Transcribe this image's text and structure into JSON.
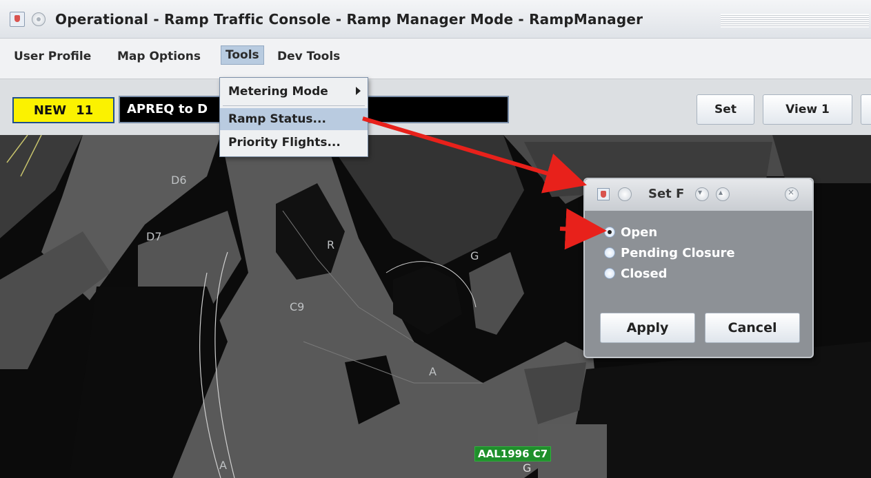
{
  "window": {
    "title": "Operational - Ramp Traffic Console - Ramp Manager Mode - RampManager"
  },
  "menubar": {
    "items": [
      {
        "label": "User Profile"
      },
      {
        "label": "Map Options"
      },
      {
        "label": "Tools"
      },
      {
        "label": "Dev Tools"
      }
    ],
    "active": "Tools"
  },
  "toolbar": {
    "new_label": "NEW",
    "new_count": "11",
    "message": "APREQ to D",
    "buttons": [
      {
        "label": "Set"
      },
      {
        "label": "View 1"
      }
    ]
  },
  "tools_menu": {
    "items": [
      {
        "label": "Metering Mode",
        "submenu": true
      },
      {
        "label": "Ramp Status...",
        "hover": true
      },
      {
        "label": "Priority Flights..."
      }
    ]
  },
  "map": {
    "labels": [
      "D6",
      "D7",
      "R",
      "C9",
      "G",
      "A",
      "A"
    ],
    "flight_tag": "AAL1996 C7",
    "gate_label": "G"
  },
  "dialog": {
    "title": "Set F",
    "options": [
      {
        "label": "Open",
        "selected": true
      },
      {
        "label": "Pending Closure",
        "selected": false
      },
      {
        "label": "Closed",
        "selected": false
      }
    ],
    "apply_label": "Apply",
    "cancel_label": "Cancel"
  },
  "colors": {
    "annotation_arrow": "#e8211b",
    "new_badge": "#fbf200",
    "flight_tag": "#1f8f2b"
  }
}
